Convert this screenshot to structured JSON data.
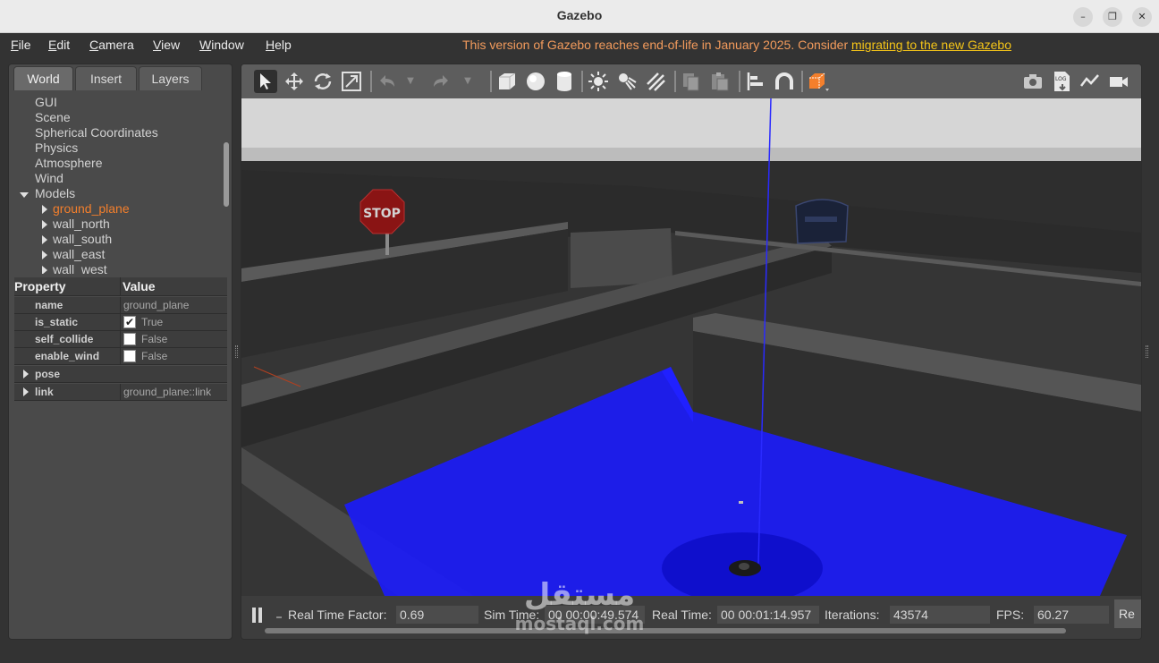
{
  "window": {
    "title": "Gazebo",
    "minimize": "–",
    "maximize": "❐",
    "close": "✕"
  },
  "menubar": {
    "items": [
      "File",
      "Edit",
      "Camera",
      "View",
      "Window",
      "Help"
    ],
    "eol_notice": "This version of Gazebo reaches end-of-life in January 2025. Consider ",
    "eol_link": "migrating to the new Gazebo"
  },
  "left_panel": {
    "tabs": [
      "World",
      "Insert",
      "Layers"
    ],
    "active_tab": "World",
    "tree": {
      "items": [
        "GUI",
        "Scene",
        "Spherical Coordinates",
        "Physics",
        "Atmosphere",
        "Wind"
      ],
      "models_label": "Models",
      "models": [
        "ground_plane",
        "wall_north",
        "wall_south",
        "wall_east",
        "wall_west"
      ],
      "selected_model": "ground_plane"
    },
    "properties": {
      "header_property": "Property",
      "header_value": "Value",
      "rows": [
        {
          "key": "name",
          "value": "ground_plane"
        },
        {
          "key": "is_static",
          "value": "True",
          "checked": true
        },
        {
          "key": "self_collide",
          "value": "False",
          "checked": false
        },
        {
          "key": "enable_wind",
          "value": "False",
          "checked": false
        },
        {
          "key": "pose",
          "value": ""
        },
        {
          "key": "link",
          "value": "ground_plane::link"
        }
      ]
    }
  },
  "toolbar": {
    "icons": [
      "select-icon",
      "translate-icon",
      "rotate-icon",
      "scale-icon",
      "undo-icon",
      "redo-icon",
      "box-icon",
      "sphere-icon",
      "cylinder-icon",
      "point-light-icon",
      "spot-light-icon",
      "directional-light-icon",
      "copy-icon",
      "paste-icon",
      "align-icon",
      "snap-icon",
      "view-angle-icon",
      "screenshot-icon",
      "log-icon",
      "plot-icon",
      "video-record-icon"
    ],
    "log_label": "LOG"
  },
  "scene": {
    "sign_text": "STOP"
  },
  "status": {
    "real_time_factor_label": "Real Time Factor:",
    "real_time_factor": "0.69",
    "sim_time_label": "Sim Time:",
    "sim_time": "00 00:00:49.574",
    "real_time_label": "Real Time:",
    "real_time": "00 00:01:14.957",
    "iterations_label": "Iterations:",
    "iterations": "43574",
    "fps_label": "FPS:",
    "fps": "60.27",
    "reset_label": "Re"
  },
  "watermark": {
    "logo_text": "مستقل",
    "domain": "mostaql.com"
  },
  "colors": {
    "accent": "#f47f2c",
    "laser": "#1a1aff",
    "eol": "#f39b5c",
    "link": "#f5c518"
  }
}
